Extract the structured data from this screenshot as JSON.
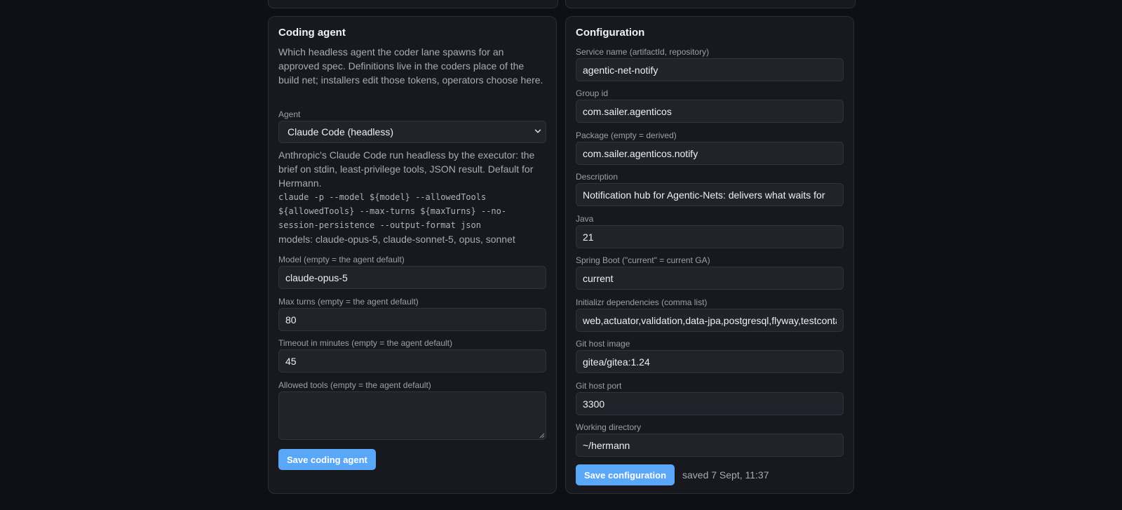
{
  "coding_agent": {
    "title": "Coding agent",
    "description": "Which headless agent the coder lane spawns for an approved spec. Definitions live in the coders place of the build net; installers edit those tokens, operators choose here.",
    "agent_label": "Agent",
    "agent_selected": "Claude Code (headless)",
    "agent_info": "Anthropic's Claude Code run headless by the executor: the brief on stdin, least-privilege tools, JSON result. Default for Hermann.",
    "command": "claude -p --model ${model} --allowedTools ${allowedTools} --max-turns ${maxTurns} --no-session-persistence --output-format json",
    "models": "models: claude-opus-5, claude-sonnet-5, opus, sonnet",
    "model_label": "Model (empty = the agent default)",
    "model_value": "claude-opus-5",
    "max_turns_label": "Max turns (empty = the agent default)",
    "max_turns_value": "80",
    "timeout_label": "Timeout in minutes (empty = the agent default)",
    "timeout_value": "45",
    "allowed_tools_label": "Allowed tools (empty = the agent default)",
    "allowed_tools_value": "",
    "save_label": "Save coding agent"
  },
  "configuration": {
    "title": "Configuration",
    "fields": {
      "service_name": {
        "label": "Service name (artifactId, repository)",
        "value": "agentic-net-notify"
      },
      "group_id": {
        "label": "Group id",
        "value": "com.sailer.agenticos"
      },
      "package": {
        "label": "Package (empty = derived)",
        "value": "com.sailer.agenticos.notify"
      },
      "description": {
        "label": "Description",
        "value": "Notification hub for Agentic-Nets: delivers what waits for"
      },
      "java": {
        "label": "Java",
        "value": "21"
      },
      "spring_boot": {
        "label": "Spring Boot (\"current\" = current GA)",
        "value": "current"
      },
      "dependencies": {
        "label": "Initializr dependencies (comma list)",
        "value": "web,actuator,validation,data-jpa,postgresql,flyway,testcontainers"
      },
      "git_host_image": {
        "label": "Git host image",
        "value": "gitea/gitea:1.24"
      },
      "git_host_port": {
        "label": "Git host port",
        "value": "3300"
      },
      "working_directory": {
        "label": "Working directory",
        "value": "~/hermann"
      }
    },
    "save_label": "Save configuration",
    "saved_status": "saved 7 Sept, 11:37"
  },
  "colors": {
    "background": "#0e1015",
    "card": "#17191f",
    "input": "#20232a",
    "accent": "#5aa7f8"
  }
}
